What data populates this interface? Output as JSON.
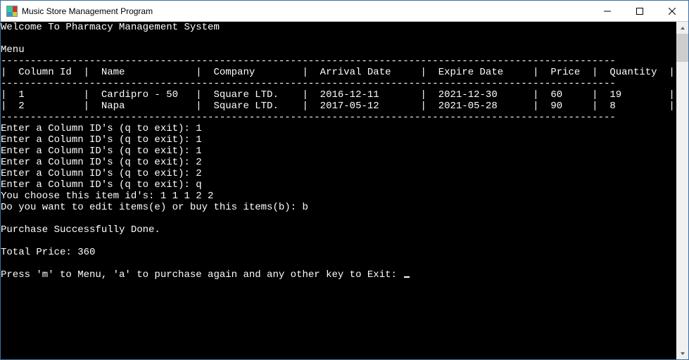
{
  "window": {
    "title": "Music Store Management Program"
  },
  "welcome": "Welcome To Pharmacy Management System",
  "menu_label": "Menu",
  "table": {
    "dash_line": "--------------------------------------------------------------------------------------------------------",
    "header": "|  Column Id  |  Name            |  Company        |  Arrival Date     |  Expire Date     |  Price  |  Quantity  |",
    "rows": [
      "|  1          |  Cardipro - 50   |  Square LTD.    |  2016-12-11       |  2021-12-30      |  60     |  19        |",
      "|  2          |  Napa            |  Square LTD.    |  2017-05-12       |  2021-05-28      |  90     |  8         |"
    ]
  },
  "prompts": [
    "Enter a Column ID's (q to exit): 1",
    "Enter a Column ID's (q to exit): 1",
    "Enter a Column ID's (q to exit): 1",
    "Enter a Column ID's (q to exit): 2",
    "Enter a Column ID's (q to exit): 2",
    "Enter a Column ID's (q to exit): q"
  ],
  "chosen_line": "You choose this item id's: 1 1 1 2 2",
  "edit_or_buy": "Do you want to edit items(e) or buy this items(b): b",
  "success": "Purchase Successfully Done.",
  "total_line": "Total Price: 360",
  "nav_prompt": "Press 'm' to Menu, 'a' to purchase again and any other key to Exit: "
}
